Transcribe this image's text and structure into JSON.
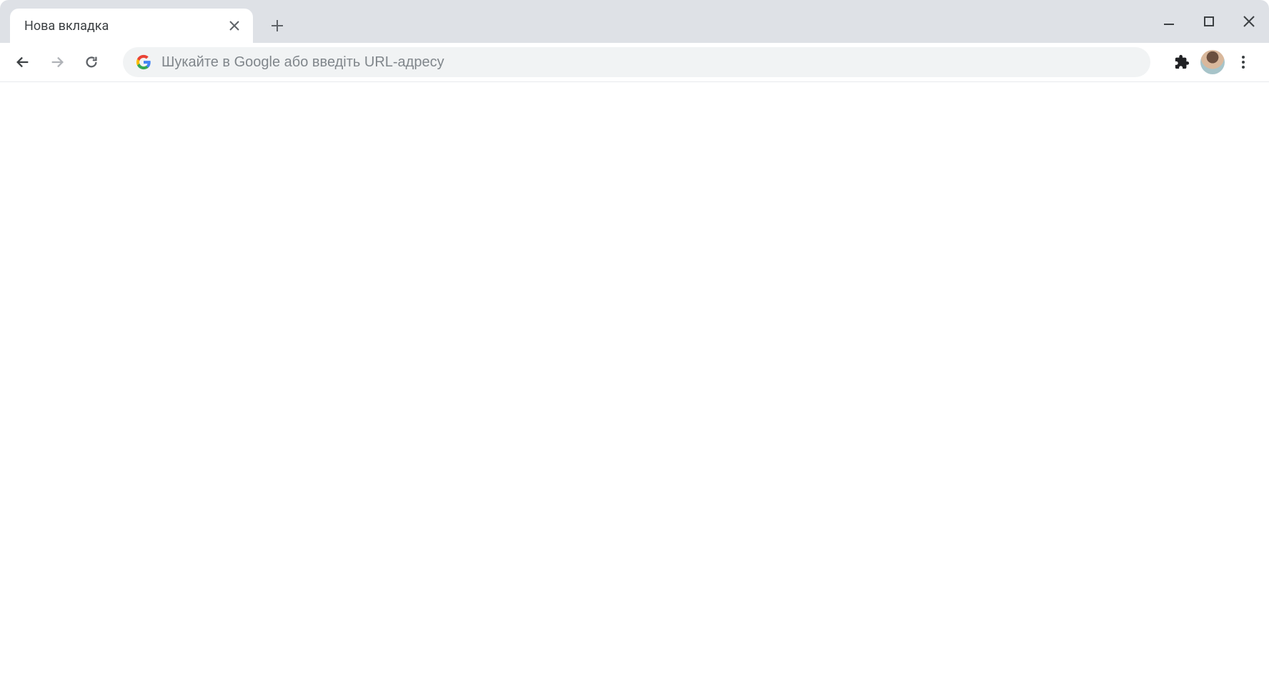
{
  "tab": {
    "title": "Нова вкладка"
  },
  "omnibox": {
    "placeholder": "Шукайте в Google або введіть URL-адресу"
  }
}
